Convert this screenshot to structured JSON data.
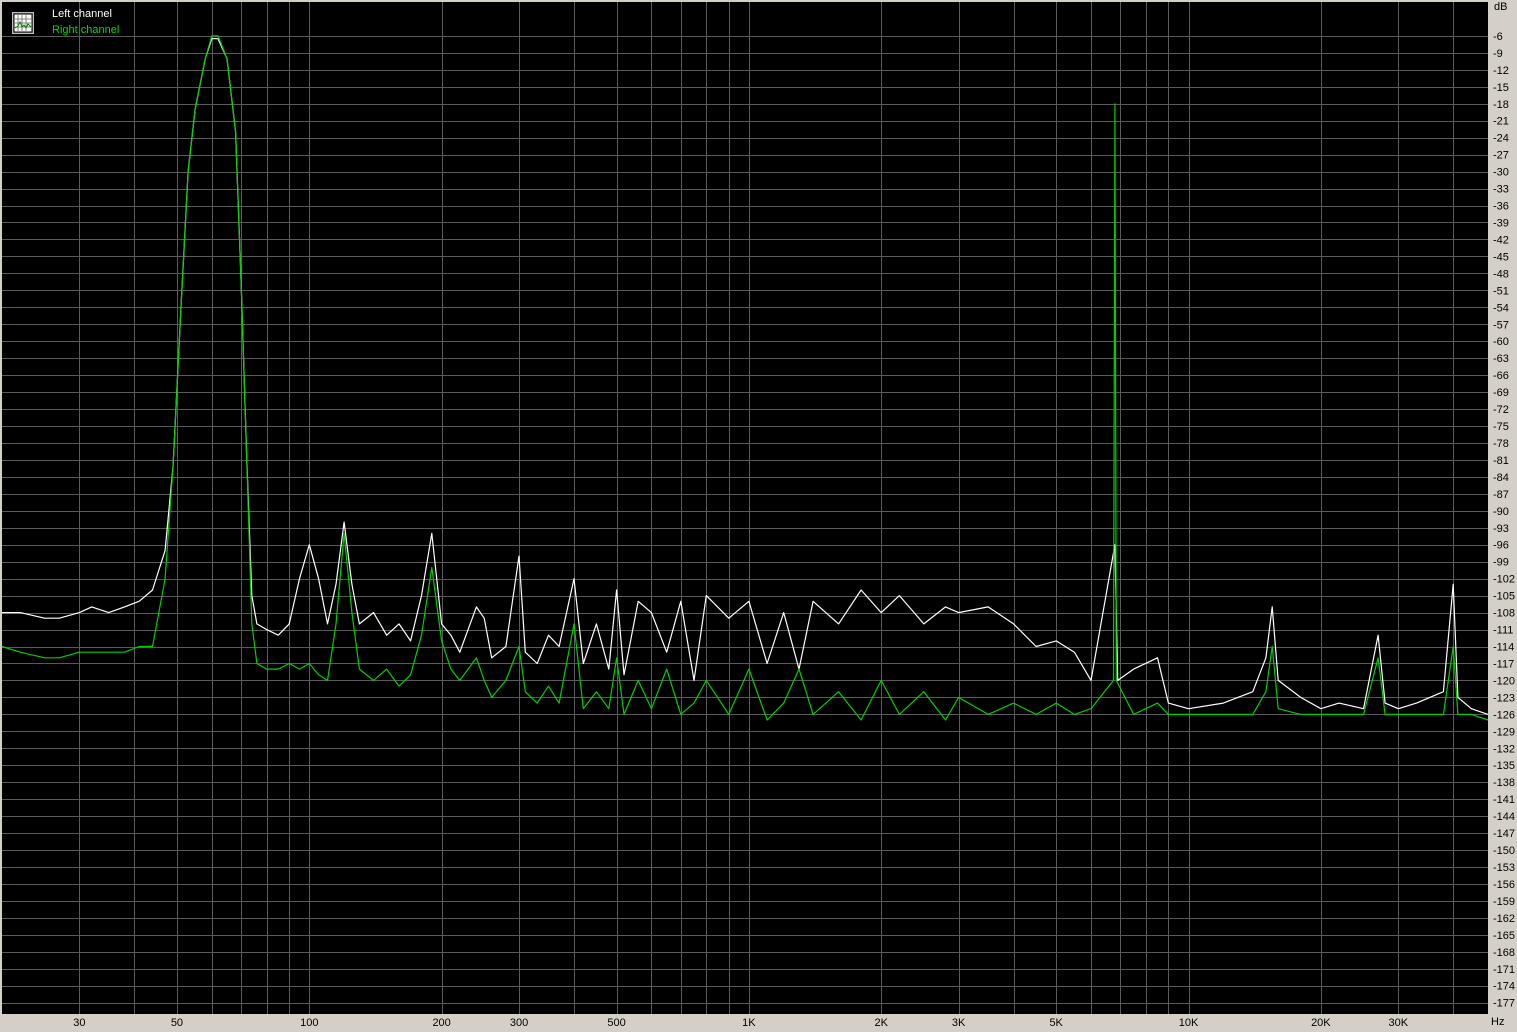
{
  "legend": {
    "left_label": "Left channel",
    "right_label": "Right channel",
    "icon": "spectrum-grid-icon"
  },
  "colors": {
    "background": "#000000",
    "grid": "#5a5a5a",
    "frame": "#d4d0c8",
    "left_channel": "#ffffff",
    "right_channel": "#00d000"
  },
  "chart_data": {
    "type": "line",
    "title": "",
    "xlabel": "Hz",
    "ylabel": "dB",
    "x_scale": "log",
    "xlim": [
      20,
      48000
    ],
    "ylim": [
      -179,
      0
    ],
    "grid": true,
    "legend_position": "top-left",
    "x_tick_labels": [
      {
        "value": 30,
        "label": "30"
      },
      {
        "value": 50,
        "label": "50"
      },
      {
        "value": 100,
        "label": "100"
      },
      {
        "value": 200,
        "label": "200"
      },
      {
        "value": 300,
        "label": "300"
      },
      {
        "value": 500,
        "label": "500"
      },
      {
        "value": 1000,
        "label": "1K"
      },
      {
        "value": 2000,
        "label": "2K"
      },
      {
        "value": 3000,
        "label": "3K"
      },
      {
        "value": 5000,
        "label": "5K"
      },
      {
        "value": 10000,
        "label": "10K"
      },
      {
        "value": 20000,
        "label": "20K"
      },
      {
        "value": 30000,
        "label": "30K"
      }
    ],
    "y_ticks": [
      -6,
      -9,
      -12,
      -15,
      -18,
      -21,
      -24,
      -27,
      -30,
      -33,
      -36,
      -39,
      -42,
      -45,
      -48,
      -51,
      -54,
      -57,
      -60,
      -63,
      -66,
      -69,
      -72,
      -75,
      -78,
      -81,
      -84,
      -87,
      -90,
      -93,
      -96,
      -99,
      -102,
      -105,
      -108,
      -111,
      -114,
      -117,
      -120,
      -123,
      -126,
      -129,
      -132,
      -135,
      -138,
      -141,
      -144,
      -147,
      -150,
      -153,
      -156,
      -159,
      -162,
      -165,
      -168,
      -171,
      -174,
      -177
    ],
    "series": [
      {
        "name": "Left channel",
        "points": [
          [
            20,
            -108
          ],
          [
            22,
            -108
          ],
          [
            25,
            -109
          ],
          [
            27,
            -109
          ],
          [
            30,
            -108
          ],
          [
            32,
            -107
          ],
          [
            35,
            -108
          ],
          [
            38,
            -107
          ],
          [
            41,
            -106
          ],
          [
            44,
            -104
          ],
          [
            47,
            -97
          ],
          [
            49,
            -82
          ],
          [
            51,
            -55
          ],
          [
            53,
            -30
          ],
          [
            55,
            -19
          ],
          [
            58,
            -10
          ],
          [
            60,
            -6.5
          ],
          [
            62,
            -6.5
          ],
          [
            65,
            -10
          ],
          [
            68,
            -23
          ],
          [
            70,
            -50
          ],
          [
            72,
            -80
          ],
          [
            74,
            -105
          ],
          [
            76,
            -110
          ],
          [
            80,
            -111
          ],
          [
            85,
            -112
          ],
          [
            90,
            -110
          ],
          [
            95,
            -102
          ],
          [
            100,
            -96
          ],
          [
            105,
            -102
          ],
          [
            110,
            -110
          ],
          [
            115,
            -103
          ],
          [
            120,
            -92
          ],
          [
            125,
            -103
          ],
          [
            130,
            -110
          ],
          [
            140,
            -108
          ],
          [
            150,
            -112
          ],
          [
            160,
            -110
          ],
          [
            170,
            -113
          ],
          [
            180,
            -105
          ],
          [
            190,
            -94
          ],
          [
            200,
            -110
          ],
          [
            210,
            -112
          ],
          [
            220,
            -115
          ],
          [
            240,
            -107
          ],
          [
            250,
            -109
          ],
          [
            260,
            -116
          ],
          [
            280,
            -114
          ],
          [
            300,
            -98
          ],
          [
            310,
            -115
          ],
          [
            330,
            -117
          ],
          [
            350,
            -112
          ],
          [
            370,
            -114
          ],
          [
            400,
            -102
          ],
          [
            420,
            -117
          ],
          [
            450,
            -110
          ],
          [
            480,
            -118
          ],
          [
            500,
            -104
          ],
          [
            520,
            -119
          ],
          [
            560,
            -106
          ],
          [
            600,
            -108
          ],
          [
            650,
            -115
          ],
          [
            700,
            -106
          ],
          [
            750,
            -120
          ],
          [
            800,
            -105
          ],
          [
            900,
            -109
          ],
          [
            1000,
            -106
          ],
          [
            1100,
            -117
          ],
          [
            1200,
            -108
          ],
          [
            1300,
            -118
          ],
          [
            1400,
            -106
          ],
          [
            1600,
            -110
          ],
          [
            1800,
            -104
          ],
          [
            2000,
            -108
          ],
          [
            2200,
            -105
          ],
          [
            2500,
            -110
          ],
          [
            2800,
            -107
          ],
          [
            3000,
            -108
          ],
          [
            3500,
            -107
          ],
          [
            4000,
            -110
          ],
          [
            4500,
            -114
          ],
          [
            5000,
            -113
          ],
          [
            5500,
            -115
          ],
          [
            6000,
            -120
          ],
          [
            6800,
            -96
          ],
          [
            6900,
            -120
          ],
          [
            7500,
            -118
          ],
          [
            8500,
            -116
          ],
          [
            9000,
            -124
          ],
          [
            10000,
            -125
          ],
          [
            12000,
            -124
          ],
          [
            14000,
            -122
          ],
          [
            15000,
            -116
          ],
          [
            15500,
            -107
          ],
          [
            16000,
            -120
          ],
          [
            18000,
            -123
          ],
          [
            20000,
            -125
          ],
          [
            22000,
            -124
          ],
          [
            25000,
            -125
          ],
          [
            27000,
            -112
          ],
          [
            28000,
            -124
          ],
          [
            30000,
            -125
          ],
          [
            33000,
            -124
          ],
          [
            38000,
            -122
          ],
          [
            40000,
            -103
          ],
          [
            41000,
            -123
          ],
          [
            44000,
            -125
          ],
          [
            48000,
            -126
          ]
        ]
      },
      {
        "name": "Right channel",
        "points": [
          [
            20,
            -114
          ],
          [
            22,
            -115
          ],
          [
            25,
            -116
          ],
          [
            27,
            -116
          ],
          [
            30,
            -115
          ],
          [
            32,
            -115
          ],
          [
            35,
            -115
          ],
          [
            38,
            -115
          ],
          [
            41,
            -114
          ],
          [
            44,
            -114
          ],
          [
            47,
            -102
          ],
          [
            49,
            -82
          ],
          [
            51,
            -55
          ],
          [
            53,
            -30
          ],
          [
            55,
            -19
          ],
          [
            58,
            -10
          ],
          [
            60,
            -6
          ],
          [
            62,
            -6
          ],
          [
            65,
            -10
          ],
          [
            68,
            -23
          ],
          [
            70,
            -50
          ],
          [
            72,
            -80
          ],
          [
            74,
            -110
          ],
          [
            76,
            -117
          ],
          [
            80,
            -118
          ],
          [
            85,
            -118
          ],
          [
            90,
            -117
          ],
          [
            95,
            -118
          ],
          [
            100,
            -117
          ],
          [
            105,
            -119
          ],
          [
            110,
            -120
          ],
          [
            115,
            -110
          ],
          [
            120,
            -94
          ],
          [
            125,
            -108
          ],
          [
            130,
            -118
          ],
          [
            140,
            -120
          ],
          [
            150,
            -118
          ],
          [
            160,
            -121
          ],
          [
            170,
            -119
          ],
          [
            180,
            -112
          ],
          [
            190,
            -100
          ],
          [
            200,
            -113
          ],
          [
            210,
            -118
          ],
          [
            220,
            -120
          ],
          [
            240,
            -116
          ],
          [
            250,
            -120
          ],
          [
            260,
            -123
          ],
          [
            280,
            -120
          ],
          [
            300,
            -114
          ],
          [
            310,
            -122
          ],
          [
            330,
            -124
          ],
          [
            350,
            -121
          ],
          [
            370,
            -124
          ],
          [
            400,
            -110
          ],
          [
            420,
            -125
          ],
          [
            450,
            -122
          ],
          [
            480,
            -125
          ],
          [
            500,
            -116
          ],
          [
            520,
            -126
          ],
          [
            560,
            -120
          ],
          [
            600,
            -125
          ],
          [
            650,
            -118
          ],
          [
            700,
            -126
          ],
          [
            750,
            -124
          ],
          [
            800,
            -120
          ],
          [
            900,
            -126
          ],
          [
            1000,
            -118
          ],
          [
            1100,
            -127
          ],
          [
            1200,
            -124
          ],
          [
            1300,
            -118
          ],
          [
            1400,
            -126
          ],
          [
            1600,
            -122
          ],
          [
            1800,
            -127
          ],
          [
            2000,
            -120
          ],
          [
            2200,
            -126
          ],
          [
            2500,
            -122
          ],
          [
            2800,
            -127
          ],
          [
            3000,
            -123
          ],
          [
            3500,
            -126
          ],
          [
            4000,
            -124
          ],
          [
            4500,
            -126
          ],
          [
            5000,
            -124
          ],
          [
            5500,
            -126
          ],
          [
            6000,
            -125
          ],
          [
            6750,
            -120
          ],
          [
            6800,
            -18
          ],
          [
            6850,
            -120
          ],
          [
            7500,
            -126
          ],
          [
            8500,
            -124
          ],
          [
            9000,
            -126
          ],
          [
            10000,
            -126
          ],
          [
            12000,
            -126
          ],
          [
            14000,
            -126
          ],
          [
            15000,
            -122
          ],
          [
            15500,
            -114
          ],
          [
            16000,
            -125
          ],
          [
            18000,
            -126
          ],
          [
            20000,
            -126
          ],
          [
            22000,
            -126
          ],
          [
            25000,
            -126
          ],
          [
            27000,
            -116
          ],
          [
            28000,
            -126
          ],
          [
            30000,
            -126
          ],
          [
            33000,
            -126
          ],
          [
            38000,
            -126
          ],
          [
            40000,
            -114
          ],
          [
            41000,
            -126
          ],
          [
            44000,
            -126
          ],
          [
            48000,
            -127
          ]
        ]
      }
    ]
  }
}
